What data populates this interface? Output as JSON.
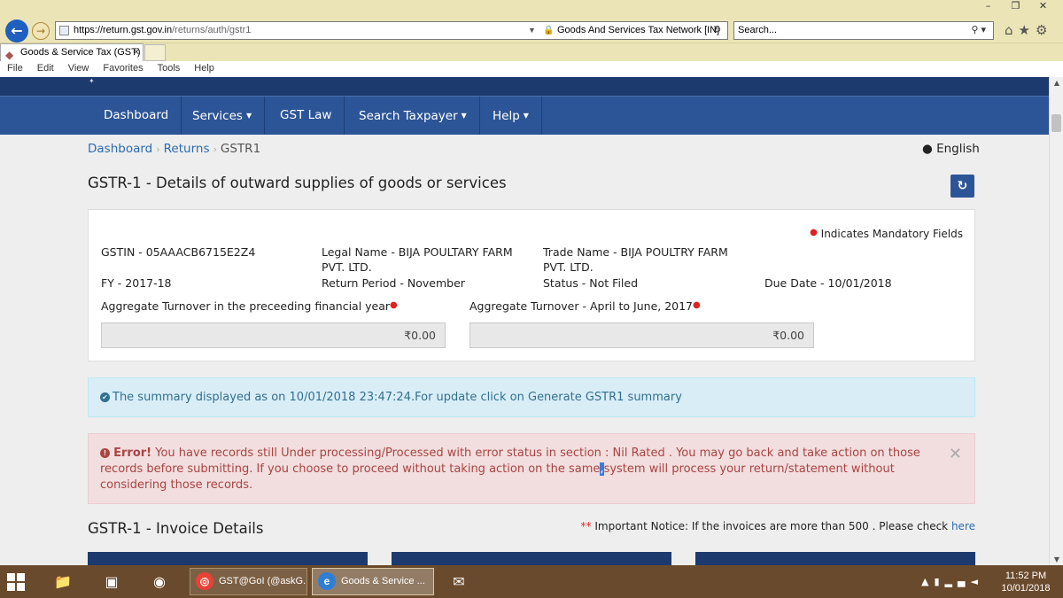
{
  "browser": {
    "url_prefix": "https://return.",
    "url_domain": "gst.gov.in",
    "url_rest": "/returns/auth/gstr1",
    "site_identity": "Goods And Services Tax Network [IN]",
    "search_placeholder": "Search...",
    "tab_title": "Goods & Service Tax (GST) | ...",
    "menu": [
      "File",
      "Edit",
      "View",
      "Favorites",
      "Tools",
      "Help"
    ]
  },
  "nav": {
    "items": [
      {
        "label": "Dashboard"
      },
      {
        "label": "Services"
      },
      {
        "label": "GST Law"
      },
      {
        "label": "Search Taxpayer"
      },
      {
        "label": "Help"
      }
    ]
  },
  "breadcrumb": {
    "dashboard": "Dashboard",
    "returns": "Returns",
    "current": "GSTR1"
  },
  "language": "English",
  "page_title": "GSTR-1 - Details of outward supplies of goods or services",
  "details": {
    "mandatory_note": "Indicates Mandatory Fields",
    "gstin": "GSTIN - 05AAACB6715E2Z4",
    "legal_name_1": "Legal Name - BIJA POULTARY FARM",
    "legal_name_2": "PVT. LTD.",
    "trade_name_1": "Trade Name - BIJA POULTRY FARM",
    "trade_name_2": "PVT. LTD.",
    "fy": "FY - 2017-18",
    "return_period": "Return Period - November",
    "status": "Status - Not Filed",
    "due_date": "Due Date - 10/01/2018",
    "turnover_prev_label": "Aggregate Turnover in the preceeding financial year",
    "turnover_prev_value": "₹0.00",
    "turnover_q_label": "Aggregate Turnover - April to June, 2017",
    "turnover_q_value": "₹0.00"
  },
  "info_message": "The summary displayed as on 10/01/2018 23:47:24.For update click on Generate GSTR1 summary",
  "error": {
    "title": "Error!",
    "text_1": " You have records still Under processing/Processed with error status in section : Nil Rated . You may go back and take action on those records before submitting. If you choose to proceed without taking action on the same",
    "selected": ",",
    "text_2": "system will process your return/statement without considering those records."
  },
  "invoice": {
    "title": "GSTR-1 - Invoice Details",
    "notice_marker": "**",
    "notice_text": " Important Notice: If the invoices are more than 500 . Please check ",
    "notice_link": "here"
  },
  "taskbar": {
    "chrome_label": "GST@GoI (@askG...",
    "ie_label": "Goods & Service ...",
    "time": "11:52 PM",
    "date": "10/01/2018"
  },
  "colors": {
    "nav_blue": "#2c5597",
    "info_bg": "#d9edf7",
    "error_bg": "#f2dede",
    "link": "#2c6bb1"
  }
}
